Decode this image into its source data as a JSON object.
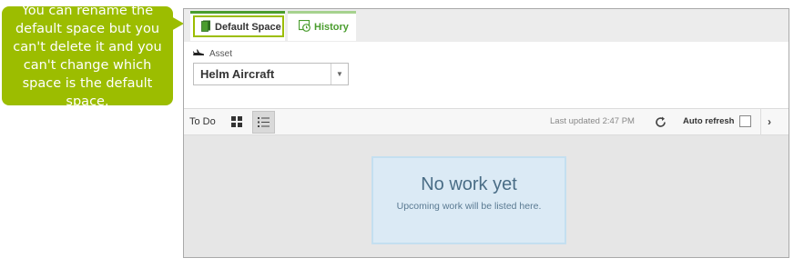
{
  "callout": {
    "text": "You can rename the default space but you can't delete it and you can't change which space is the default space."
  },
  "tabs": [
    {
      "label": "Default Space",
      "icon": "book-icon"
    },
    {
      "label": "History",
      "icon": "history-icon"
    }
  ],
  "asset": {
    "label": "Asset",
    "icon": "aircraft-icon",
    "selected": "Helm Aircraft"
  },
  "toolbar": {
    "todo_label": "To Do",
    "last_updated": "Last updated 2:47 PM",
    "auto_refresh_label": "Auto refresh",
    "auto_refresh_checked": false,
    "next_glyph": "›"
  },
  "empty_state": {
    "title": "No work yet",
    "subtitle": "Upcoming work will be listed here."
  },
  "colors": {
    "callout": "#9cbd00",
    "accent_green": "#4a9d2e",
    "empty_card_bg": "#dbeaf5"
  }
}
